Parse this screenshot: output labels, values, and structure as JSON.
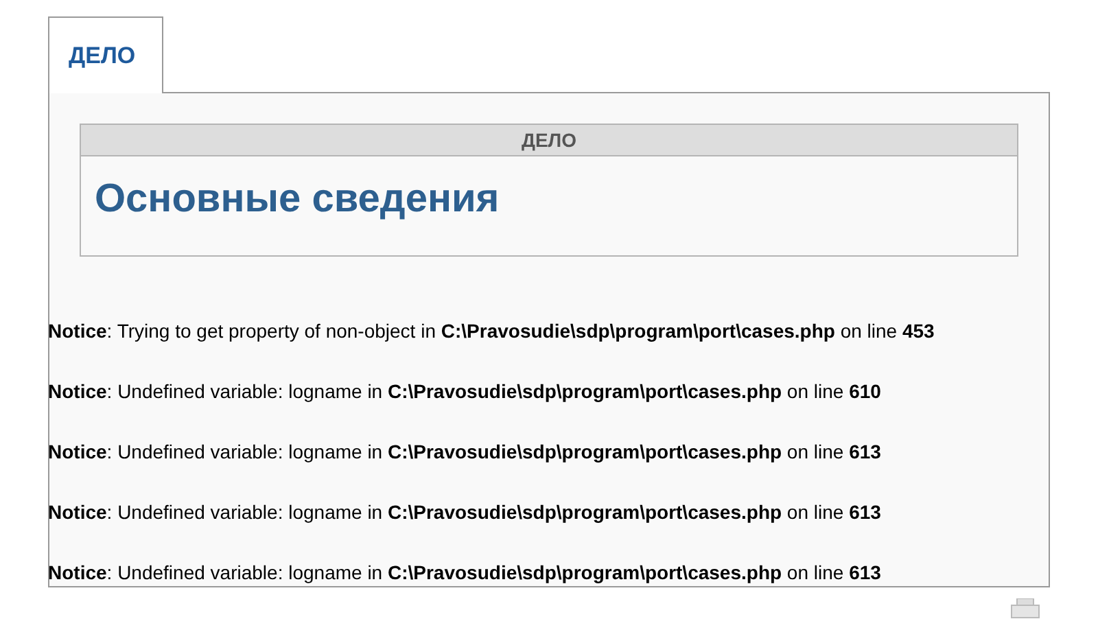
{
  "tabs": [
    {
      "label": "ДЕЛО",
      "selected": true
    }
  ],
  "section": {
    "header": "ДЕЛО",
    "title": "Основные сведения"
  },
  "notices": [
    "**Notice**: Trying to get property of non-object in **C:\\Pravosudie\\sdp\\program\\port\\cases.php** on line **453**",
    "**Notice**: Undefined variable: logname in **C:\\Pravosudie\\sdp\\program\\port\\cases.php** on line **610**",
    "**Notice**: Undefined variable: logname in **C:\\Pravosudie\\sdp\\program\\port\\cases.php** on line **613**",
    "**Notice**: Undefined variable: logname in **C:\\Pravosudie\\sdp\\program\\port\\cases.php** on line **613**",
    "**Notice**: Undefined variable: logname in **C:\\Pravosudie\\sdp\\program\\port\\cases.php** on line **613**"
  ]
}
